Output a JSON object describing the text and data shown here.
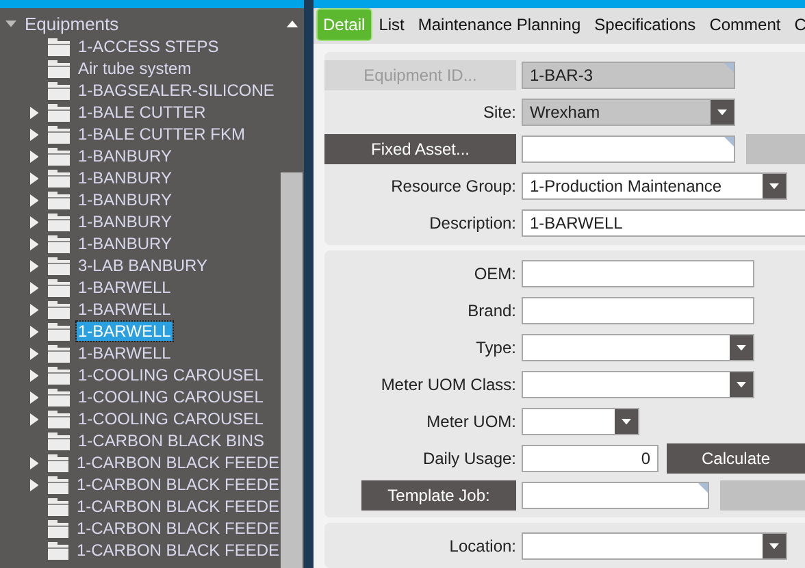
{
  "tree": {
    "title": "Equipments",
    "expanded": true,
    "items": [
      {
        "label": "1-ACCESS STEPS",
        "expander": false,
        "selected": false
      },
      {
        "label": "Air tube system",
        "expander": false,
        "selected": false
      },
      {
        "label": "1-BAGSEALER-SILICONE",
        "expander": false,
        "selected": false
      },
      {
        "label": "1-BALE CUTTER",
        "expander": true,
        "selected": false
      },
      {
        "label": "1-BALE CUTTER FKM",
        "expander": true,
        "selected": false
      },
      {
        "label": "1-BANBURY",
        "expander": true,
        "selected": false
      },
      {
        "label": "1-BANBURY",
        "expander": true,
        "selected": false
      },
      {
        "label": "1-BANBURY",
        "expander": true,
        "selected": false
      },
      {
        "label": "1-BANBURY",
        "expander": true,
        "selected": false
      },
      {
        "label": "1-BANBURY",
        "expander": true,
        "selected": false
      },
      {
        "label": "3-LAB BANBURY",
        "expander": true,
        "selected": false
      },
      {
        "label": "1-BARWELL",
        "expander": true,
        "selected": false
      },
      {
        "label": "1-BARWELL",
        "expander": true,
        "selected": false
      },
      {
        "label": "1-BARWELL",
        "expander": true,
        "selected": true
      },
      {
        "label": "1-BARWELL",
        "expander": true,
        "selected": false
      },
      {
        "label": "1-COOLING CAROUSEL",
        "expander": true,
        "selected": false
      },
      {
        "label": "1-COOLING CAROUSEL",
        "expander": true,
        "selected": false
      },
      {
        "label": "1-COOLING CAROUSEL",
        "expander": true,
        "selected": false
      },
      {
        "label": "1-CARBON BLACK BINS",
        "expander": false,
        "selected": false
      },
      {
        "label": "1-CARBON BLACK FEEDE",
        "expander": true,
        "selected": false
      },
      {
        "label": "1-CARBON BLACK FEEDE",
        "expander": true,
        "selected": false
      },
      {
        "label": "1-CARBON BLACK FEEDE",
        "expander": false,
        "selected": false
      },
      {
        "label": "1-CARBON BLACK FEEDE",
        "expander": false,
        "selected": false
      },
      {
        "label": "1-CARBON BLACK FEEDE",
        "expander": false,
        "selected": false
      }
    ]
  },
  "tabs": [
    {
      "label": "Detail",
      "selected": true
    },
    {
      "label": "List",
      "selected": false
    },
    {
      "label": "Maintenance Planning",
      "selected": false
    },
    {
      "label": "Specifications",
      "selected": false
    },
    {
      "label": "Comment",
      "selected": false
    },
    {
      "label": "C",
      "selected": false
    }
  ],
  "panels": [
    {
      "rows": [
        {
          "label": "Equipment ID...",
          "kind": "button",
          "disabled": true,
          "field": {
            "kind": "lookup",
            "value": "1-BAR-3",
            "readonly": true
          }
        },
        {
          "label": "Site:",
          "kind": "text",
          "field": {
            "kind": "dropdown",
            "value": "Wrexham",
            "readonly": true
          }
        },
        {
          "label": "Fixed Asset...",
          "kind": "button",
          "disabled": false,
          "field": {
            "kind": "lookup",
            "readonly": false
          },
          "extra": {
            "kind": "blank"
          }
        },
        {
          "label": "Resource Group:",
          "kind": "text",
          "field": {
            "kind": "dropdown",
            "value": "1-Production Maintenance",
            "readonly": false
          }
        },
        {
          "label": "Description:",
          "kind": "text",
          "field": {
            "kind": "text",
            "value": "1-BARWELL",
            "readonly": false
          }
        }
      ]
    },
    {
      "rows": [
        {
          "label": "OEM:",
          "kind": "text",
          "field": {
            "kind": "text",
            "readonly": false
          }
        },
        {
          "label": "Brand:",
          "kind": "text",
          "field": {
            "kind": "text",
            "readonly": false
          }
        },
        {
          "label": "Type:",
          "kind": "text",
          "field": {
            "kind": "dropdown",
            "readonly": false
          }
        },
        {
          "label": "Meter UOM Class:",
          "kind": "text",
          "field": {
            "kind": "dropdown",
            "readonly": false
          }
        },
        {
          "label": "Meter UOM:",
          "kind": "text",
          "field": {
            "kind": "dropdown",
            "readonly": false
          }
        },
        {
          "label": "Daily Usage:",
          "kind": "text",
          "field": {
            "kind": "number",
            "value": "0",
            "readonly": false
          },
          "extra": {
            "kind": "button",
            "label": "Calculate"
          }
        },
        {
          "label": "Template Job:",
          "kind": "button",
          "disabled": false,
          "field": {
            "kind": "lookup",
            "readonly": false
          },
          "extra": {
            "kind": "blank"
          }
        }
      ]
    },
    {
      "rows": [
        {
          "label": "Location:",
          "kind": "text",
          "field": {
            "kind": "dropdown",
            "readonly": false
          }
        }
      ]
    }
  ]
}
